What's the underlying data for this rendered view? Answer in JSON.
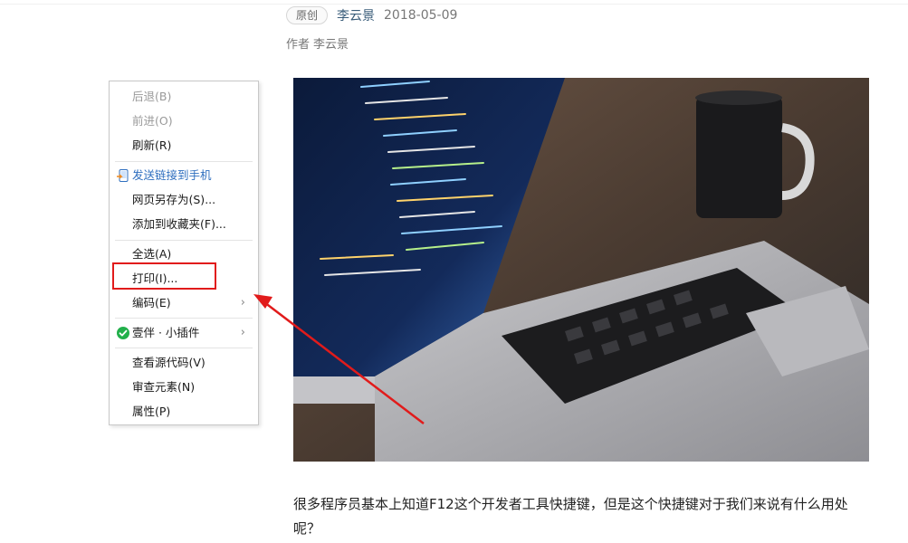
{
  "article": {
    "tag": "原创",
    "author": "李云景",
    "date": "2018-05-09",
    "byline_label": "作者",
    "byline_author": "李云景",
    "paragraph": "很多程序员基本上知道F12这个开发者工具快捷键，但是这个快捷键对于我们来说有什么用处呢？"
  },
  "context_menu": {
    "items": [
      {
        "label": "后退(B)",
        "enabled": false
      },
      {
        "label": "前进(O)",
        "enabled": false
      },
      {
        "label": "刷新(R)",
        "enabled": true
      },
      {
        "label": "发送链接到手机",
        "enabled": true,
        "icon": "phone-send-icon"
      },
      {
        "label": "网页另存为(S)...",
        "enabled": true
      },
      {
        "label": "添加到收藏夹(F)...",
        "enabled": true
      },
      {
        "label": "全选(A)",
        "enabled": true
      },
      {
        "label": "打印(I)...",
        "enabled": true,
        "highlighted": true
      },
      {
        "label": "编码(E)",
        "enabled": true,
        "submenu": true
      },
      {
        "label": "壹伴 · 小插件",
        "enabled": true,
        "submenu": true,
        "icon": "checkmark-badge-icon"
      },
      {
        "label": "查看源代码(V)",
        "enabled": true
      },
      {
        "label": "审查元素(N)",
        "enabled": true
      },
      {
        "label": "属性(P)",
        "enabled": true
      }
    ],
    "submenu_glyph": "›"
  },
  "colors": {
    "highlight_box": "#e11b1b",
    "arrow": "#e11b1b",
    "link_blue": "#2f6fbf",
    "plugin_badge": "#22b04b"
  },
  "hero_image": {
    "icon": "laptop-code-photo"
  }
}
